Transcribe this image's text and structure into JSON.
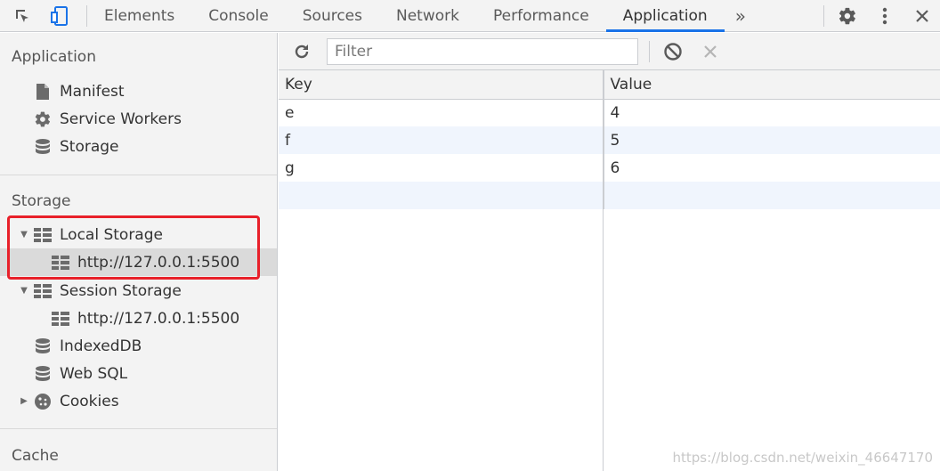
{
  "toolbar": {
    "tabs": [
      "Elements",
      "Console",
      "Sources",
      "Network",
      "Performance",
      "Application"
    ],
    "active_tab": "Application",
    "overflow": "»"
  },
  "sidebar": {
    "sections": {
      "application": "Application",
      "storage": "Storage",
      "cache": "Cache"
    },
    "application_items": [
      "Manifest",
      "Service Workers",
      "Storage"
    ],
    "storage_items": {
      "local_storage": "Local Storage",
      "local_storage_origin": "http://127.0.0.1:5500",
      "session_storage": "Session Storage",
      "session_storage_origin": "http://127.0.0.1:5500",
      "indexeddb": "IndexedDB",
      "websql": "Web SQL",
      "cookies": "Cookies"
    },
    "highlight_color": "#e8202a"
  },
  "main": {
    "filter_placeholder": "Filter",
    "columns": [
      "Key",
      "Value"
    ],
    "rows": [
      [
        "e",
        "4"
      ],
      [
        "f",
        "5"
      ],
      [
        "g",
        "6"
      ]
    ]
  },
  "watermark": "https://blog.csdn.net/weixin_46647170"
}
